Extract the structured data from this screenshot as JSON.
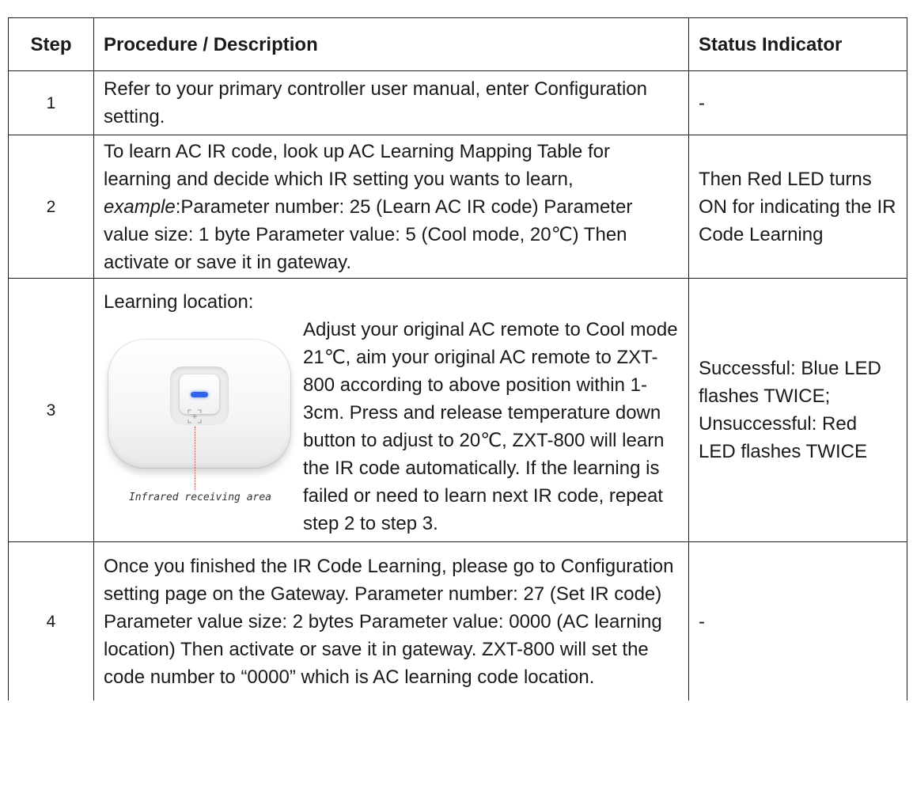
{
  "table": {
    "headers": {
      "step": "Step",
      "procedure": "Procedure / Description",
      "status": "Status Indicator"
    },
    "rows": [
      {
        "step": "1",
        "procedure": "Refer to your primary controller user manual, enter Configuration setting.",
        "status": "-"
      },
      {
        "step": "2",
        "procedure_intro": "To learn AC IR code, look up AC Learning Mapping Table for learning and decide which IR setting you wants to learn,",
        "procedure_example_label": "example",
        "procedure_example_text": ":Parameter number: 25 (Learn AC IR code) Parameter value size: 1 byte Parameter value: 5 (Cool mode, 20℃) Then activate or save it in gateway.",
        "status": "Then Red LED turns ON for indicating the IR Code Learning"
      },
      {
        "step": "3",
        "procedure_label": "Learning location:",
        "procedure_text": "Adjust your original AC remote to Cool mode 21℃, aim your original AC remote to ZXT-800 according to above position within 1-3cm. Press and release temperature down button to adjust to 20℃, ZXT-800 will learn the IR code automatically. If the learning is failed or need to learn next IR code, repeat step 2 to step 3.",
        "figure_caption": "Infrared receiving area",
        "status": "Successful: Blue LED flashes TWICE; Unsuccessful: Red LED flashes TWICE"
      },
      {
        "step": "4",
        "procedure": "Once you finished the IR Code Learning, please go to Configuration setting page on the Gateway. Parameter number: 27 (Set IR code) Parameter value size: 2 bytes Parameter value: 0000 (AC learning location) Then activate or save it in gateway. ZXT-800 will set the code number to “0000” which is AC learning code location.",
        "status": "-"
      }
    ]
  },
  "colors": {
    "border": "#1a1a1a",
    "led_blue": "#2f63e8",
    "guide_line_red": "#c0392b"
  },
  "icons": {
    "device": "zxt-800-device-icon",
    "ir_target": "ir-target-icon"
  }
}
